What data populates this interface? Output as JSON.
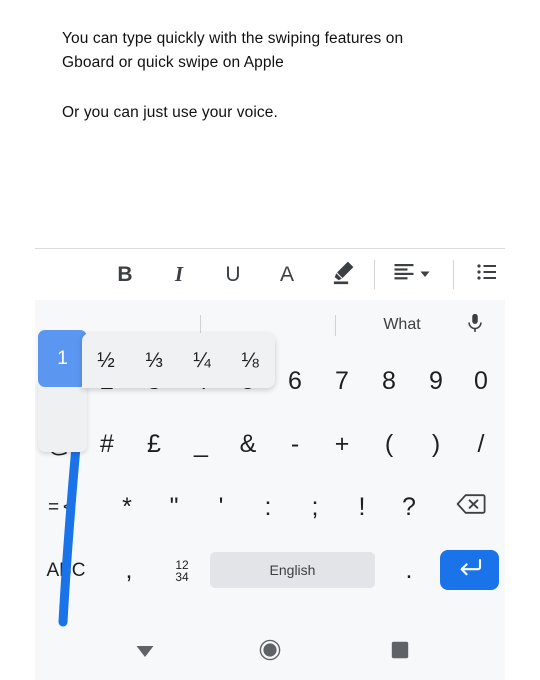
{
  "document": {
    "paragraph_1": "You can type quickly with the swiping features on\nGboard or quick swipe on Apple",
    "paragraph_2": "Or you can just use your voice."
  },
  "toolbar": {
    "bold_label": "B",
    "italic_label": "I",
    "underline_label": "U",
    "text_color_label": "A",
    "highlight_icon": "highlighter-pen-icon",
    "align_icon": "align-left-icon",
    "align_dropdown_icon": "chevron-down-icon",
    "list_icon": "bulleted-list-icon"
  },
  "keyboard": {
    "suggestions": [
      "",
      "",
      "What"
    ],
    "mic_icon": "microphone-icon",
    "pressed_key": {
      "label": "1",
      "highlight_color": "#5b97f0"
    },
    "accent_popup": {
      "options": [
        "½",
        "⅓",
        "¼",
        "⅛"
      ]
    },
    "row_1": [
      "1",
      "2",
      "3",
      "4",
      "5",
      "6",
      "7",
      "8",
      "9",
      "0"
    ],
    "row_2": [
      "@",
      "#",
      "£",
      "_",
      "&",
      "-",
      "+",
      "(",
      ")",
      "/"
    ],
    "row_3": [
      "= <",
      "*",
      "\"",
      "'",
      ":",
      ";",
      "!",
      "?",
      "backspace-icon"
    ],
    "row_4": {
      "alpha_key": "ABC",
      "comma_key": ",",
      "numeric_key": "12\n34",
      "space_key": "English",
      "period_key": ".",
      "enter_key": "enter-icon"
    },
    "swipe_trail_color": "#1a73e8",
    "enter_key_color": "#1a73e8",
    "space_key_color": "#e2e4e7",
    "background_color": "#f7f8fa"
  },
  "navbar": {
    "back_icon": "hide-keyboard-down-arrow-icon",
    "home_icon": "home-circle-icon",
    "recents_icon": "recents-square-icon"
  }
}
